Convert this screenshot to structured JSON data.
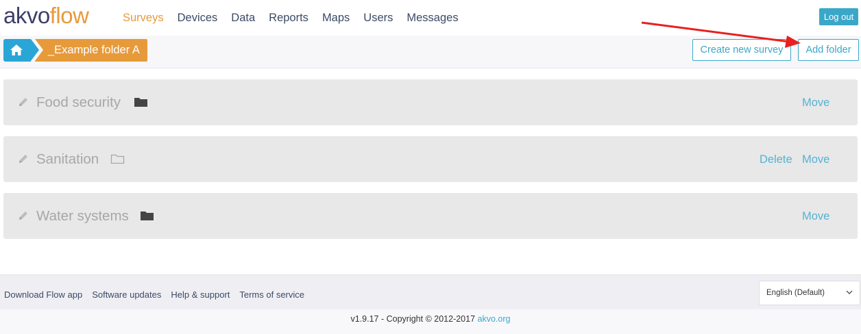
{
  "logo": {
    "part1": "akvo",
    "part2": "flow"
  },
  "nav": {
    "items": [
      {
        "label": "Surveys",
        "active": true
      },
      {
        "label": "Devices"
      },
      {
        "label": "Data"
      },
      {
        "label": "Reports"
      },
      {
        "label": "Maps"
      },
      {
        "label": "Users"
      },
      {
        "label": "Messages"
      }
    ]
  },
  "header": {
    "logout_label": "Log out"
  },
  "breadcrumb": {
    "home_icon": "home-icon",
    "folder_label": "_Example folder A"
  },
  "toolbar": {
    "create_survey_label": "Create new survey",
    "add_folder_label": "Add folder"
  },
  "rows": [
    {
      "title": "Food security",
      "folder_icon": "folder-filled-icon",
      "actions": [
        "Move"
      ]
    },
    {
      "title": "Sanitation",
      "folder_icon": "folder-outline-icon",
      "actions": [
        "Delete",
        "Move"
      ]
    },
    {
      "title": "Water systems",
      "folder_icon": "folder-filled-icon",
      "actions": [
        "Move"
      ]
    }
  ],
  "footer": {
    "links": [
      "Download Flow app",
      "Software updates",
      "Help & support",
      "Terms of service"
    ],
    "language": "English (Default)",
    "copyright_text": "v1.9.17 - Copyright © 2012-2017",
    "copyright_link": "akvo.org"
  },
  "colors": {
    "accent_orange": "#e79a3a",
    "accent_blue": "#3aa7c9",
    "annotation_arrow": "#e8201e"
  }
}
